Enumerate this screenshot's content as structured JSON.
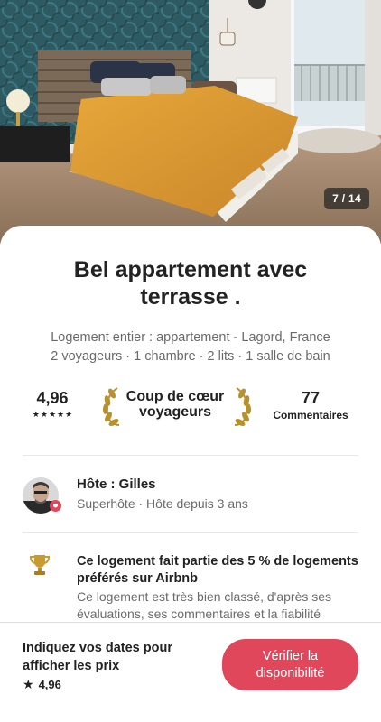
{
  "photo": {
    "counter": "7 / 14",
    "description_icon": "bedroom-photo"
  },
  "listing": {
    "title": "Bel appartement avec terrasse .",
    "subtitle_line1": "Logement entier : appartement - Lagord, France",
    "subtitle_line2": "2 voyageurs · 1 chambre · 2 lits · 1 salle de bain"
  },
  "stats": {
    "rating": "4,96",
    "stars": 5,
    "badge_label": "Coup de cœur voyageurs",
    "reviews_count": "77",
    "reviews_label": "Commentaires"
  },
  "host": {
    "name": "Hôte : Gilles",
    "details": "Superhôte · Hôte depuis 3 ans"
  },
  "highlight": {
    "icon": "trophy-icon",
    "title": "Ce logement fait partie des 5 % de logements préférés sur Airbnb",
    "text": "Ce logement est très bien classé, d'après ses évaluations, ses commentaires et la fiabilité"
  },
  "footer": {
    "prompt": "Indiquez vos dates pour afficher les prix",
    "rating": "4,96",
    "cta_label": "Vérifier la disponibilité"
  },
  "colors": {
    "accent": "#e0475b",
    "text": "#222222",
    "muted": "#6a6a6a"
  }
}
